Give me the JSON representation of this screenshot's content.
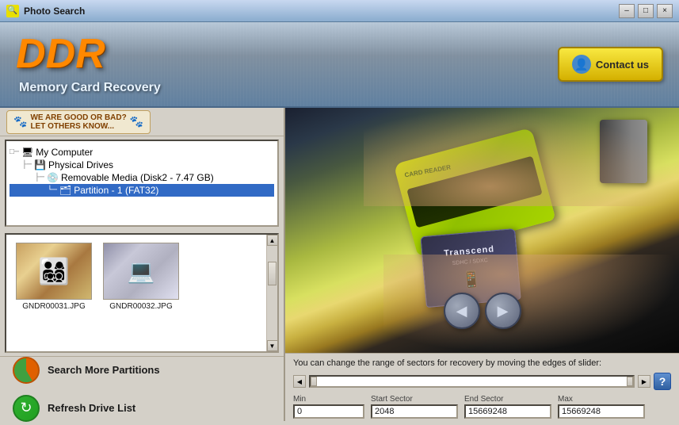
{
  "titlebar": {
    "title": "Photo Search",
    "minimize": "–",
    "maximize": "□",
    "close": "×"
  },
  "header": {
    "logo": "DDR",
    "subtitle": "Memory Card Recovery",
    "contact_button": "Contact us"
  },
  "badge": {
    "line1": "WE ARE GOOD OR BAD?",
    "line2": "LET OTHERS KNOW..."
  },
  "tree": {
    "items": [
      {
        "id": "my-computer",
        "label": "My Computer",
        "level": 0,
        "prefix": "□─"
      },
      {
        "id": "physical-drives",
        "label": "Physical Drives",
        "level": 1,
        "prefix": "├─"
      },
      {
        "id": "removable-media",
        "label": "Removable Media (Disk2 - 7.47 GB)",
        "level": 2,
        "prefix": "├─"
      },
      {
        "id": "partition-1",
        "label": "Partition - 1 (FAT32)",
        "level": 3,
        "prefix": "└─",
        "selected": true
      }
    ]
  },
  "thumbnails": [
    {
      "id": "thumb1",
      "filename": "GNDR00031.JPG"
    },
    {
      "id": "thumb2",
      "filename": "GNDR00032.JPG"
    }
  ],
  "buttons": {
    "search_partitions": "Search More Partitions",
    "refresh_drive": "Refresh Drive List"
  },
  "preview": {
    "sd_brand": "Transcend",
    "sd_type": "SDHC / SDXC"
  },
  "nav": {
    "back": "◀",
    "forward": "▶"
  },
  "slider": {
    "label": "You can change the range of sectors for recovery by moving the edges of slider:",
    "help": "?",
    "min_label": "Min",
    "max_label": "Max",
    "start_label": "Start Sector",
    "end_label": "End Sector",
    "min_value": "0",
    "start_value": "2048",
    "end_value": "15669248",
    "max_value": "15669248"
  }
}
